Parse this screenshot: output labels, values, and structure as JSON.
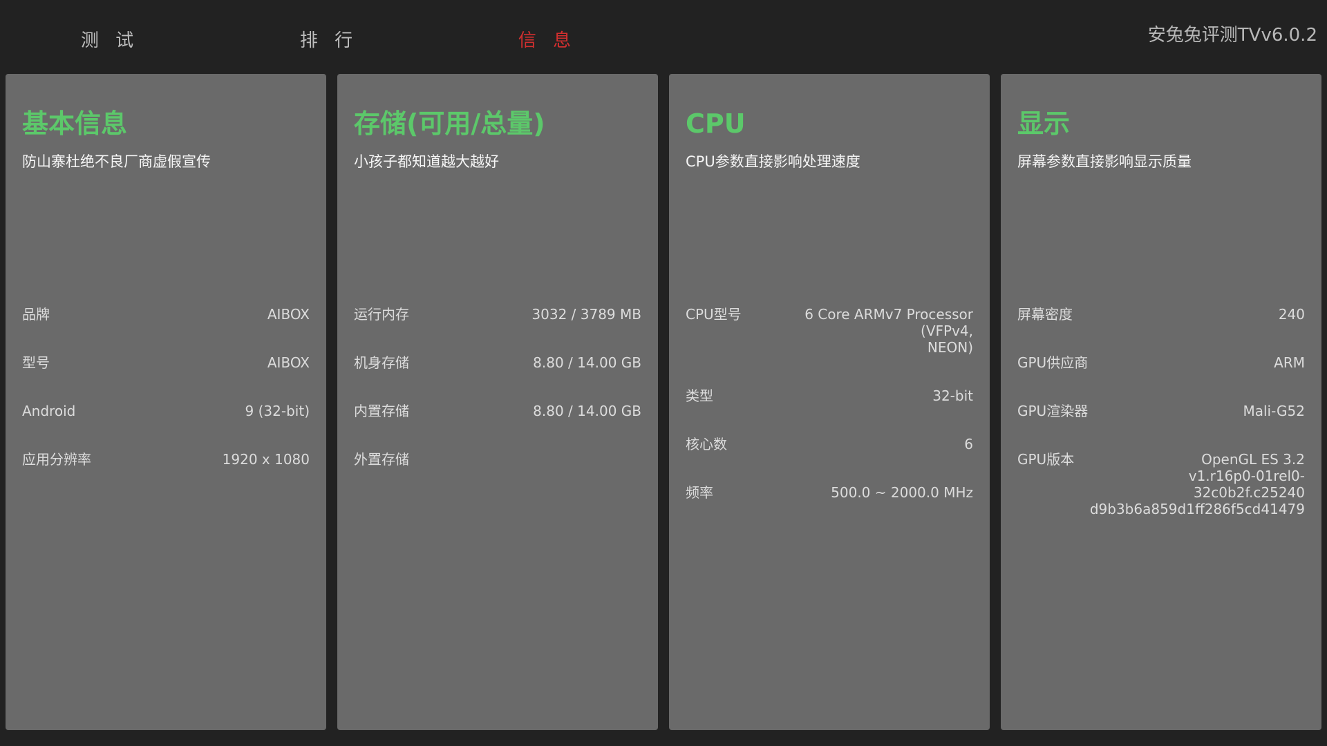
{
  "tabs": [
    {
      "label": "测 试"
    },
    {
      "label": "排 行"
    },
    {
      "label": "信 息",
      "active": true
    }
  ],
  "app_title": "安兔兔评测TVv6.0.2",
  "colors": {
    "accent_green": "#5cc86a",
    "active_tab": "#d32f2f",
    "card_bg": "#6a6a6a",
    "page_bg": "#222222"
  },
  "cards": {
    "basic": {
      "title": "基本信息",
      "subtitle": "防山寨杜绝不良厂商虚假宣传",
      "rows": [
        {
          "label": "品牌",
          "value": "AIBOX"
        },
        {
          "label": "型号",
          "value": "AIBOX"
        },
        {
          "label": "Android",
          "value": "9 (32-bit)"
        },
        {
          "label": "应用分辨率",
          "value": "1920 x 1080"
        }
      ]
    },
    "storage": {
      "title": "存储(可用/总量)",
      "subtitle": "小孩子都知道越大越好",
      "rows": [
        {
          "label": "运行内存",
          "value": "3032 / 3789 MB"
        },
        {
          "label": "机身存储",
          "value": "8.80 / 14.00 GB"
        },
        {
          "label": "内置存储",
          "value": "8.80 / 14.00 GB"
        },
        {
          "label": "外置存储",
          "value": ""
        }
      ]
    },
    "cpu": {
      "title": "CPU",
      "subtitle": "CPU参数直接影响处理速度",
      "rows": [
        {
          "label": "CPU型号",
          "value": "6 Core ARMv7 Processor (VFPv4,\nNEON)"
        },
        {
          "label": "类型",
          "value": "32-bit"
        },
        {
          "label": "核心数",
          "value": "6"
        },
        {
          "label": "频率",
          "value": "500.0 ~ 2000.0 MHz"
        }
      ]
    },
    "display": {
      "title": "显示",
      "subtitle": "屏幕参数直接影响显示质量",
      "rows": [
        {
          "label": "屏幕密度",
          "value": "240"
        },
        {
          "label": "GPU供应商",
          "value": "ARM"
        },
        {
          "label": "GPU渲染器",
          "value": "Mali-G52"
        },
        {
          "label": "GPU版本",
          "value": "OpenGL ES 3.2\nv1.r16p0-01rel0-32c0b2f.c25240\nd9b3b6a859d1ff286f5cd41479"
        }
      ]
    }
  }
}
